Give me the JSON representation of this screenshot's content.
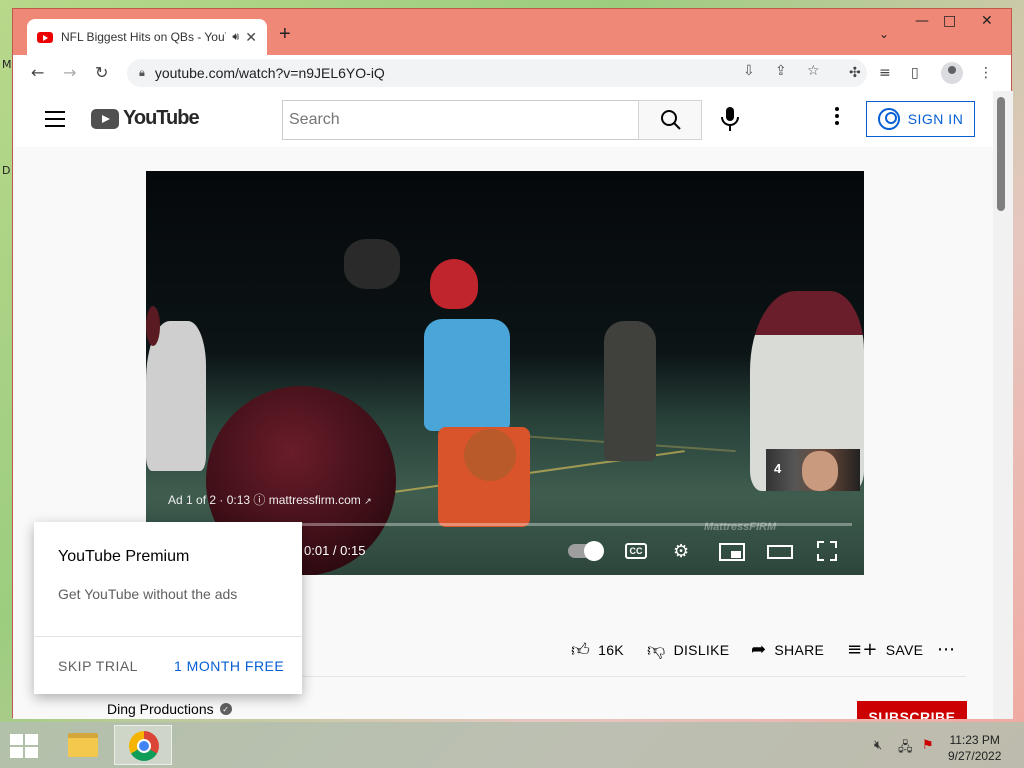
{
  "desktop": {
    "fragment_1": "M",
    "fragment_2": "D"
  },
  "browser": {
    "tab_title": "NFL Biggest Hits on QBs - YouTube",
    "new_tab": "+",
    "url": "youtube.com/watch?v=n9JEL6YO-iQ",
    "window_controls": {
      "minimize": "—",
      "maximize": "□",
      "close": "✕"
    }
  },
  "youtube": {
    "logo": "YouTube",
    "search_placeholder": "Search",
    "sign_in": "SIGN IN"
  },
  "player": {
    "ad_info": "Ad 1 of 2 · 0:13",
    "ad_domain": "mattressfirm.com",
    "ad_queue_number": "4",
    "watermark": "MattressFIRM",
    "time": "0:01 / 0:15",
    "cc": "CC",
    "progress": 0.02
  },
  "actions": {
    "likes": "16K",
    "dislike": "DISLIKE",
    "share": "SHARE",
    "save": "SAVE"
  },
  "channel": {
    "name": "Ding Productions",
    "subscribe": "SUBSCRIBE"
  },
  "premium_popup": {
    "title": "YouTube Premium",
    "text": "Get YouTube without the ads",
    "skip": "SKIP TRIAL",
    "cta": "1 MONTH FREE"
  },
  "taskbar": {
    "time": "11:23 PM",
    "date": "9/27/2022"
  },
  "colors": {
    "accent_blue": "#065fd4",
    "subscribe_red": "#cc0000",
    "title_bar": "#f08878"
  }
}
